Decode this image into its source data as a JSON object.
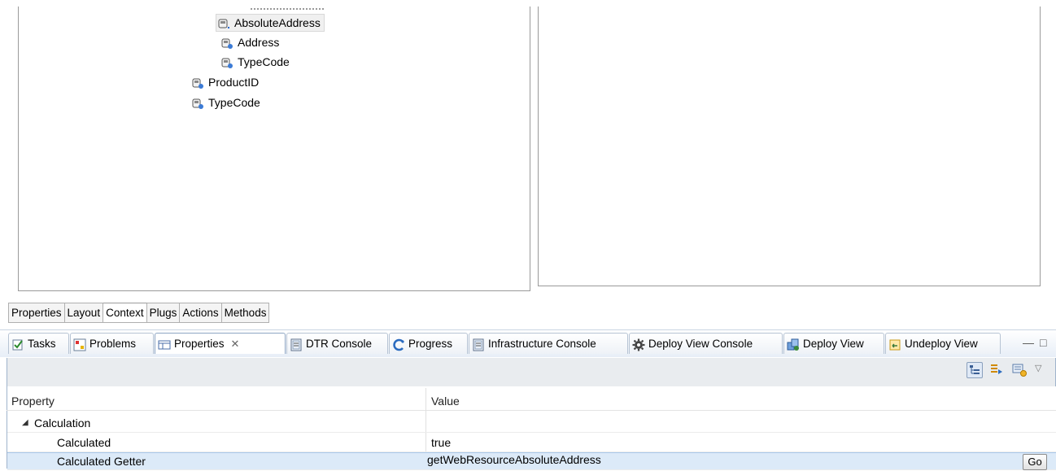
{
  "tree": {
    "items": [
      {
        "label": "AbsoluteAddress",
        "selected": true,
        "icon": "attribute-icon"
      },
      {
        "label": "Address",
        "icon": "attribute-icon"
      },
      {
        "label": "TypeCode",
        "icon": "attribute-icon"
      },
      {
        "label": "ProductID",
        "icon": "attribute-icon"
      },
      {
        "label": "TypeCode",
        "icon": "attribute-icon"
      }
    ]
  },
  "editor_tabs": [
    "Properties",
    "Layout",
    "Context",
    "Plugs",
    "Actions",
    "Methods"
  ],
  "editor_active_tab": "Context",
  "views": {
    "tabs": [
      {
        "label": "Tasks",
        "icon": "tasks-icon"
      },
      {
        "label": "Problems",
        "icon": "problems-icon"
      },
      {
        "label": "Properties",
        "icon": "properties-icon",
        "active": true,
        "close": "✕"
      },
      {
        "label": "DTR Console",
        "icon": "console-icon"
      },
      {
        "label": "Progress",
        "icon": "progress-icon"
      },
      {
        "label": "Infrastructure Console",
        "icon": "console-icon"
      },
      {
        "label": "Deploy View Console",
        "icon": "gear-icon"
      },
      {
        "label": "Deploy View",
        "icon": "deploy-icon"
      },
      {
        "label": "Undeploy View",
        "icon": "undeploy-icon"
      }
    ]
  },
  "properties": {
    "header": {
      "property": "Property",
      "value": "Value"
    },
    "category": "Calculation",
    "rows": [
      {
        "property": "Calculated",
        "value": "true"
      },
      {
        "property": "Calculated Getter",
        "value": "getWebResourceAbsoluteAddress",
        "selected": true
      }
    ],
    "go_label": "Go"
  },
  "colors": {
    "selection": "#dceaf8",
    "view_border": "#9fb3cc",
    "tab_strip": "#e7eef7"
  }
}
